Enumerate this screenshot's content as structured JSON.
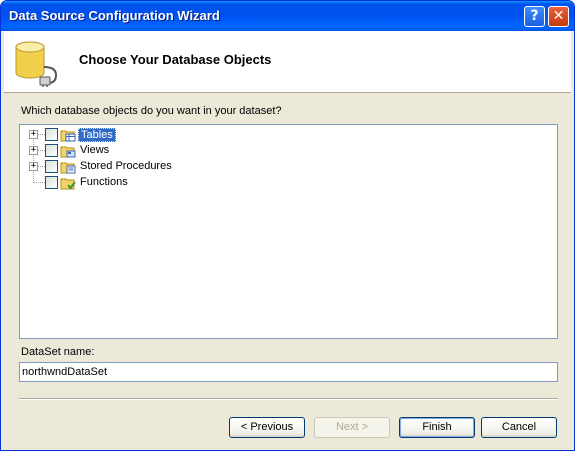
{
  "window": {
    "title": "Data Source Configuration Wizard"
  },
  "header": {
    "title": "Choose Your Database Objects"
  },
  "prompt": "Which database objects do you want in your dataset?",
  "tree": {
    "items": [
      {
        "label": "Tables",
        "expandable": true,
        "checked": false,
        "selected": true,
        "icon": "tables-folder-icon"
      },
      {
        "label": "Views",
        "expandable": true,
        "checked": false,
        "selected": false,
        "icon": "views-folder-icon"
      },
      {
        "label": "Stored Procedures",
        "expandable": true,
        "checked": false,
        "selected": false,
        "icon": "stored-procedures-folder-icon"
      },
      {
        "label": "Functions",
        "expandable": false,
        "checked": false,
        "selected": false,
        "icon": "functions-folder-icon"
      }
    ]
  },
  "dataset": {
    "label": "DataSet name:",
    "value": "northwndDataSet"
  },
  "buttons": {
    "previous": "< Previous",
    "next": "Next >",
    "finish": "Finish",
    "cancel": "Cancel"
  },
  "colors": {
    "titlebar": "#0054e3",
    "selection": "#316ac5",
    "dialog_bg": "#ece9d8"
  }
}
